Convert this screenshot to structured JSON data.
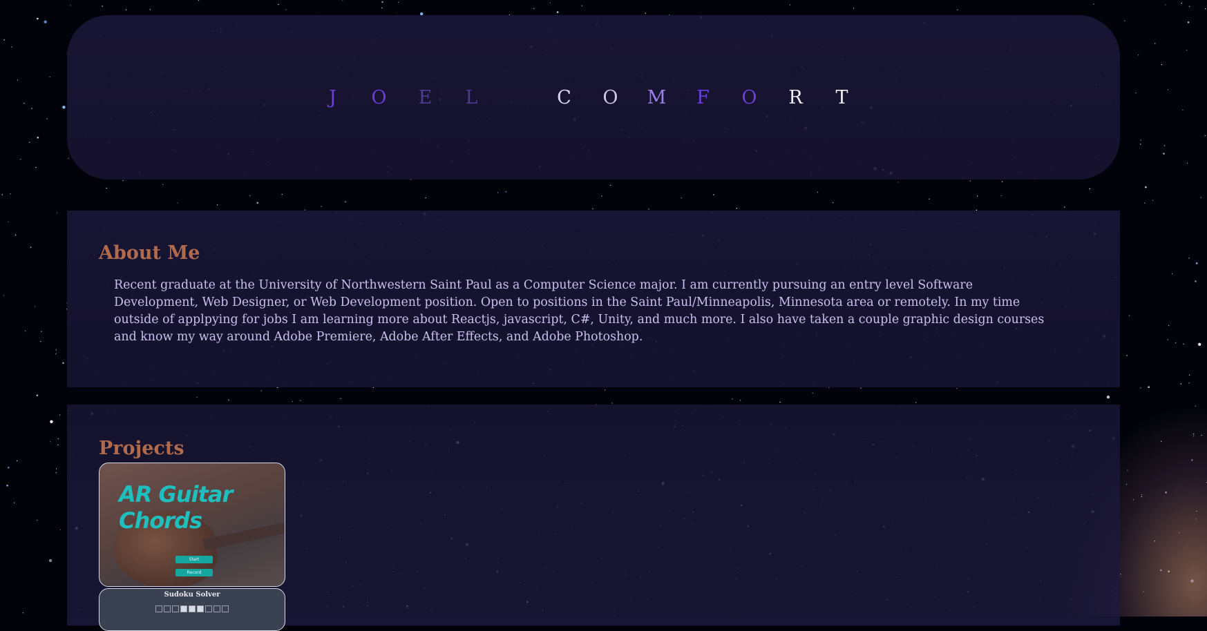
{
  "header": {
    "title_letters": [
      "J",
      "O",
      "E",
      "L",
      " ",
      "C",
      "O",
      "M",
      "F",
      "O",
      "R",
      "T"
    ]
  },
  "colors": {
    "accent_purple": "#6c3fd6",
    "heading": "#b06a4c",
    "text": "#c9c0ee"
  },
  "about": {
    "heading": "About Me",
    "body": "Recent graduate at the University of Northwestern Saint Paul as a Computer Science major. I am currently pursuing an entry level Software Development, Web Designer, or Web Development position. Open to positions in the Saint Paul/Minneapolis, Minnesota area or remotely. In my time outside of applpying for jobs I am learning more about Reactjs, javascript, C#, Unity, and much more. I also have taken a couple graphic design courses and know my way around Adobe Premiere, Adobe After Effects, and Adobe Photoshop."
  },
  "projects": {
    "heading": "Projects",
    "items": [
      {
        "title": "AR Guitar Chords",
        "buttons": [
          "Start",
          "Record"
        ]
      },
      {
        "title": "Sudoku Solver"
      }
    ]
  }
}
